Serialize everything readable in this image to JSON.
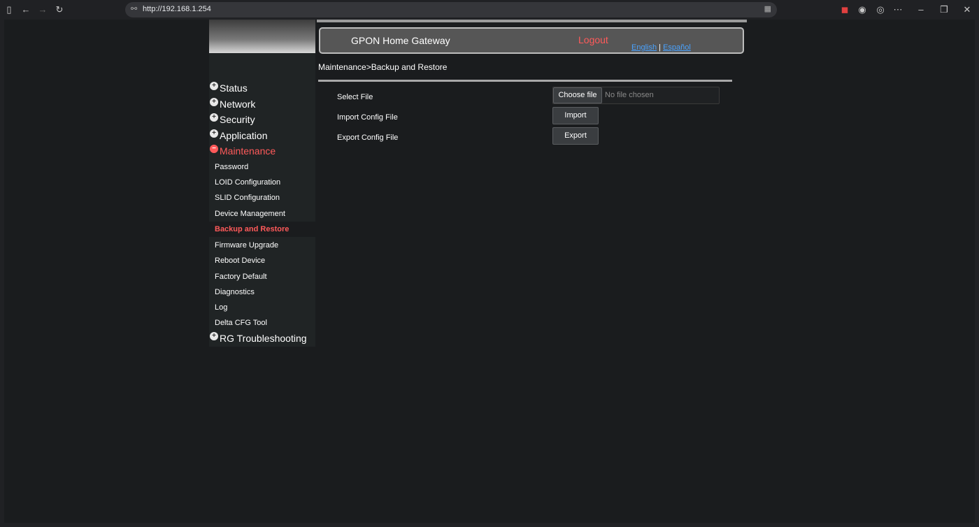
{
  "browser": {
    "url": "http://192.168.1.254"
  },
  "header": {
    "title": "GPON Home Gateway",
    "logout": "Logout",
    "lang_english": "English",
    "lang_separator": "|",
    "lang_espanol": "Español"
  },
  "breadcrumb": "Maintenance>Backup and Restore",
  "menu": {
    "status": "Status",
    "network": "Network",
    "security": "Security",
    "application": "Application",
    "maintenance": "Maintenance",
    "rg_troubleshooting": "RG Troubleshooting"
  },
  "submenu": {
    "password": "Password",
    "loid": "LOID Configuration",
    "slid": "SLID Configuration",
    "device_management": "Device Management",
    "backup_restore": "Backup and Restore",
    "firmware": "Firmware Upgrade",
    "reboot": "Reboot Device",
    "factory": "Factory Default",
    "diagnostics": "Diagnostics",
    "log": "Log",
    "delta_cfg": "Delta CFG Tool"
  },
  "form": {
    "select_file_label": "Select File",
    "choose_file_button": "Choose file",
    "no_file": "No file chosen",
    "import_label": "Import Config File",
    "import_button": "Import",
    "export_label": "Export Config File",
    "export_button": "Export"
  },
  "colors": {
    "accent": "#ff5a5a",
    "link": "#4aa3ff",
    "background": "#1a1c1e"
  }
}
